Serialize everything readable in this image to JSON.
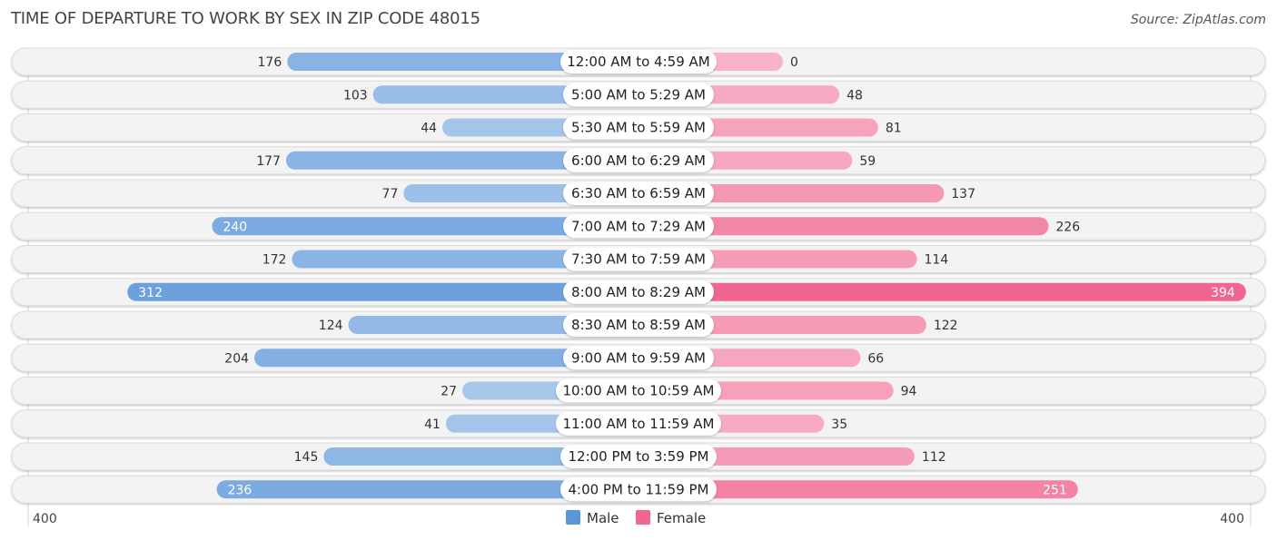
{
  "title": "TIME OF DEPARTURE TO WORK BY SEX IN ZIP CODE 48015",
  "source": "Source: ZipAtlas.com",
  "chart_data": {
    "type": "bar",
    "orientation": "horizontal-diverging",
    "title": "TIME OF DEPARTURE TO WORK BY SEX IN ZIP CODE 48015",
    "categories": [
      "12:00 AM to 4:59 AM",
      "5:00 AM to 5:29 AM",
      "5:30 AM to 5:59 AM",
      "6:00 AM to 6:29 AM",
      "6:30 AM to 6:59 AM",
      "7:00 AM to 7:29 AM",
      "7:30 AM to 7:59 AM",
      "8:00 AM to 8:29 AM",
      "8:30 AM to 8:59 AM",
      "9:00 AM to 9:59 AM",
      "10:00 AM to 10:59 AM",
      "11:00 AM to 11:59 AM",
      "12:00 PM to 3:59 PM",
      "4:00 PM to 11:59 PM"
    ],
    "series": [
      {
        "name": "Male",
        "color": "#5b96d9",
        "values": [
          176,
          103,
          44,
          177,
          77,
          240,
          172,
          312,
          124,
          204,
          27,
          41,
          145,
          236
        ]
      },
      {
        "name": "Female",
        "color": "#f06690",
        "values": [
          0,
          48,
          81,
          59,
          137,
          226,
          114,
          394,
          122,
          66,
          94,
          35,
          112,
          251
        ]
      }
    ],
    "axis": {
      "left_label": "400",
      "right_label": "400",
      "max": 400
    },
    "legend": {
      "position": "bottom-center",
      "items": [
        "Male",
        "Female"
      ]
    },
    "xlabel": "",
    "ylabel": ""
  }
}
